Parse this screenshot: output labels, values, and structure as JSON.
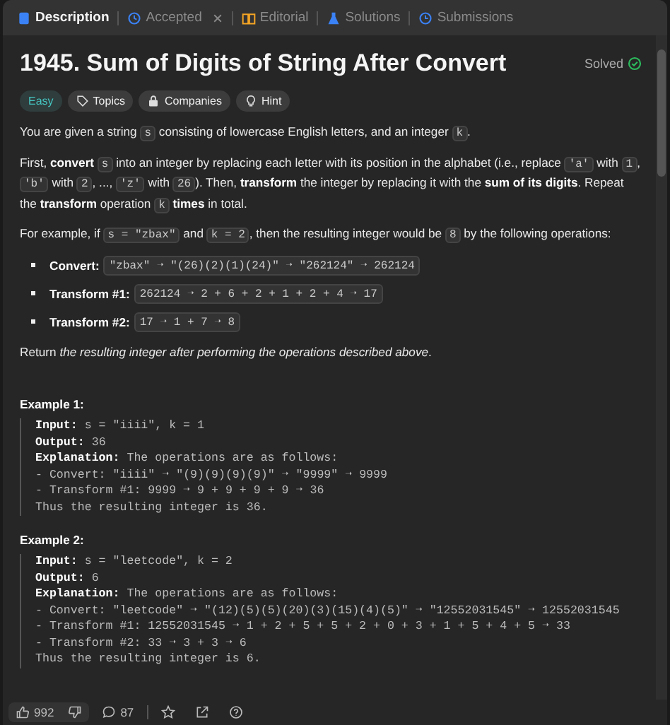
{
  "tabs": [
    {
      "label": "Description",
      "selected": true,
      "closable": false
    },
    {
      "label": "Accepted",
      "selected": false,
      "closable": true
    },
    {
      "label": "Editorial",
      "selected": false,
      "closable": false
    },
    {
      "label": "Solutions",
      "selected": false,
      "closable": false
    },
    {
      "label": "Submissions",
      "selected": false,
      "closable": false
    }
  ],
  "problem": {
    "title": "1945. Sum of Digits of String After Convert",
    "status": "Solved"
  },
  "tags": [
    {
      "label": "Easy",
      "kind": "difficulty"
    },
    {
      "label": "Topics",
      "kind": "tag"
    },
    {
      "label": "Companies",
      "kind": "lock"
    },
    {
      "label": "Hint",
      "kind": "bulb"
    }
  ],
  "paragraphs": [
    [
      {
        "kind": "text",
        "t": "You are given a string "
      },
      {
        "kind": "code",
        "t": "s"
      },
      {
        "kind": "text",
        "t": " consisting of lowercase English letters, and an integer "
      },
      {
        "kind": "code",
        "t": "k"
      },
      {
        "kind": "text",
        "t": "."
      }
    ],
    [
      {
        "kind": "text",
        "t": "First, "
      },
      {
        "kind": "bold",
        "t": "convert "
      },
      {
        "kind": "code",
        "t": "s"
      },
      {
        "kind": "text",
        "t": " into an integer by replacing each letter with its position in the alphabet (i.e., replace "
      },
      {
        "kind": "code",
        "t": "'a'"
      },
      {
        "kind": "text",
        "t": " with "
      },
      {
        "kind": "code",
        "t": "1"
      },
      {
        "kind": "text",
        "t": ", "
      },
      {
        "kind": "code",
        "t": "'b'"
      },
      {
        "kind": "text",
        "t": " with "
      },
      {
        "kind": "code",
        "t": "2"
      },
      {
        "kind": "text",
        "t": ", ..., "
      },
      {
        "kind": "code",
        "t": "'z'"
      },
      {
        "kind": "text",
        "t": " with "
      },
      {
        "kind": "code",
        "t": "26"
      },
      {
        "kind": "text",
        "t": "). Then, "
      },
      {
        "kind": "bold",
        "t": "transform"
      },
      {
        "kind": "text",
        "t": " the integer by replacing it with the "
      },
      {
        "kind": "bold",
        "t": "sum of its digits"
      },
      {
        "kind": "text",
        "t": ". Repeat the "
      },
      {
        "kind": "bold",
        "t": "transform"
      },
      {
        "kind": "text",
        "t": " operation "
      },
      {
        "kind": "code",
        "t": "k"
      },
      {
        "kind": "bold",
        "t": " times"
      },
      {
        "kind": "text",
        "t": " in total."
      }
    ],
    [
      {
        "kind": "text",
        "t": "For example, if "
      },
      {
        "kind": "code",
        "t": "s = \"zbax\""
      },
      {
        "kind": "text",
        "t": " and "
      },
      {
        "kind": "code",
        "t": "k = 2"
      },
      {
        "kind": "text",
        "t": ", then the resulting integer would be "
      },
      {
        "kind": "code",
        "t": "8"
      },
      {
        "kind": "text",
        "t": " by the following operations:"
      }
    ]
  ],
  "bullets": [
    {
      "label": "Convert:",
      "code": "\"zbax\" ➝ \"(26)(2)(1)(24)\" ➝ \"262124\" ➝ 262124"
    },
    {
      "label": "Transform #1:",
      "code": "262124 ➝ 2 + 6 + 2 + 1 + 2 + 4 ➝ 17"
    },
    {
      "label": "Transform #2:",
      "code": "17 ➝ 1 + 7 ➝ 8"
    }
  ],
  "closing": [
    {
      "kind": "text",
      "t": "Return "
    },
    {
      "kind": "italic",
      "t": "the resulting integer after performing the operations described above"
    },
    {
      "kind": "text",
      "t": "."
    }
  ],
  "examples": [
    {
      "title": "Example 1:",
      "lines": [
        {
          "kind": "field",
          "label": "Input:",
          "value": "s = \"iiii\", k = 1"
        },
        {
          "kind": "field",
          "label": "Output:",
          "value": "36"
        },
        {
          "kind": "field",
          "label": "Explanation:",
          "value": "The operations are as follows:"
        },
        {
          "kind": "plain",
          "value": "- Convert: \"iiii\" ➝ \"(9)(9)(9)(9)\" ➝ \"9999\" ➝ 9999"
        },
        {
          "kind": "plain",
          "value": "- Transform #1: 9999 ➝ 9 + 9 + 9 + 9 ➝ 36"
        },
        {
          "kind": "plain",
          "value": "Thus the resulting integer is 36."
        }
      ]
    },
    {
      "title": "Example 2:",
      "lines": [
        {
          "kind": "field",
          "label": "Input:",
          "value": "s = \"leetcode\", k = 2"
        },
        {
          "kind": "field",
          "label": "Output:",
          "value": "6"
        },
        {
          "kind": "field",
          "label": "Explanation:",
          "value": "The operations are as follows:"
        },
        {
          "kind": "plain",
          "value": "- Convert: \"leetcode\" ➝ \"(12)(5)(5)(20)(3)(15)(4)(5)\" ➝ \"12552031545\" ➝ 12552031545"
        },
        {
          "kind": "plain",
          "value": "- Transform #1: 12552031545 ➝ 1 + 2 + 5 + 5 + 2 + 0 + 3 + 1 + 5 + 4 + 5 ➝ 33"
        },
        {
          "kind": "plain",
          "value": "- Transform #2: 33 ➝ 3 + 3 ➝ 6"
        },
        {
          "kind": "plain",
          "value": "Thus the resulting integer is 6."
        }
      ]
    }
  ],
  "footer": {
    "likes": "992",
    "comments": "87"
  }
}
